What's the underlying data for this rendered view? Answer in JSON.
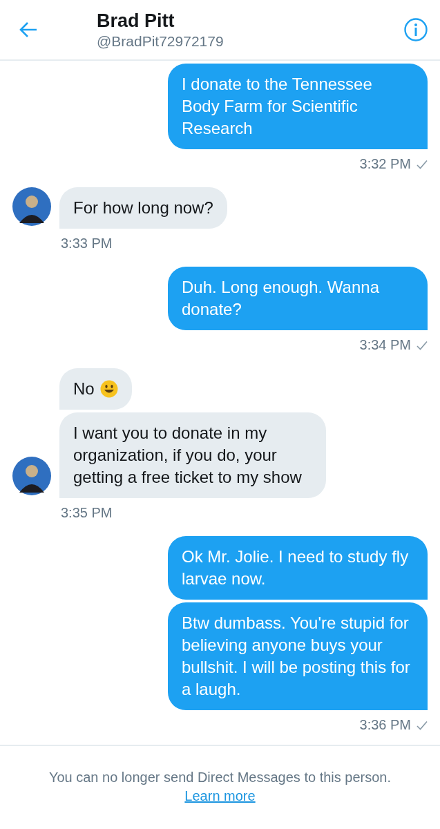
{
  "header": {
    "name": "Brad Pitt",
    "handle": "@BradPit72972179"
  },
  "groups": [
    {
      "kind": "sent",
      "messages": [
        {
          "text": "I donate to the Tennessee Body Farm for Scientific Research"
        }
      ],
      "time": "3:32 PM"
    },
    {
      "kind": "received",
      "messages": [
        {
          "text": "For how long now?"
        }
      ],
      "time": "3:33 PM"
    },
    {
      "kind": "sent",
      "messages": [
        {
          "text": "Duh. Long enough. Wanna donate?"
        }
      ],
      "time": "3:34 PM"
    },
    {
      "kind": "received",
      "messages": [
        {
          "text": "No",
          "kind": "with_emoji"
        },
        {
          "text": "I want you to donate in my organization, if you do, your getting a free ticket to my show"
        }
      ],
      "time": "3:35 PM"
    },
    {
      "kind": "sent",
      "messages": [
        {
          "text": "Ok Mr. Jolie. I need to study fly larvae now."
        },
        {
          "text": "Btw dumbass. You're stupid for believing anyone buys your bullshit. I will be posting this for a laugh."
        }
      ],
      "time": "3:36 PM"
    }
  ],
  "footer": {
    "notice": "You can no longer send Direct Messages to this person.",
    "link": "Learn more"
  }
}
